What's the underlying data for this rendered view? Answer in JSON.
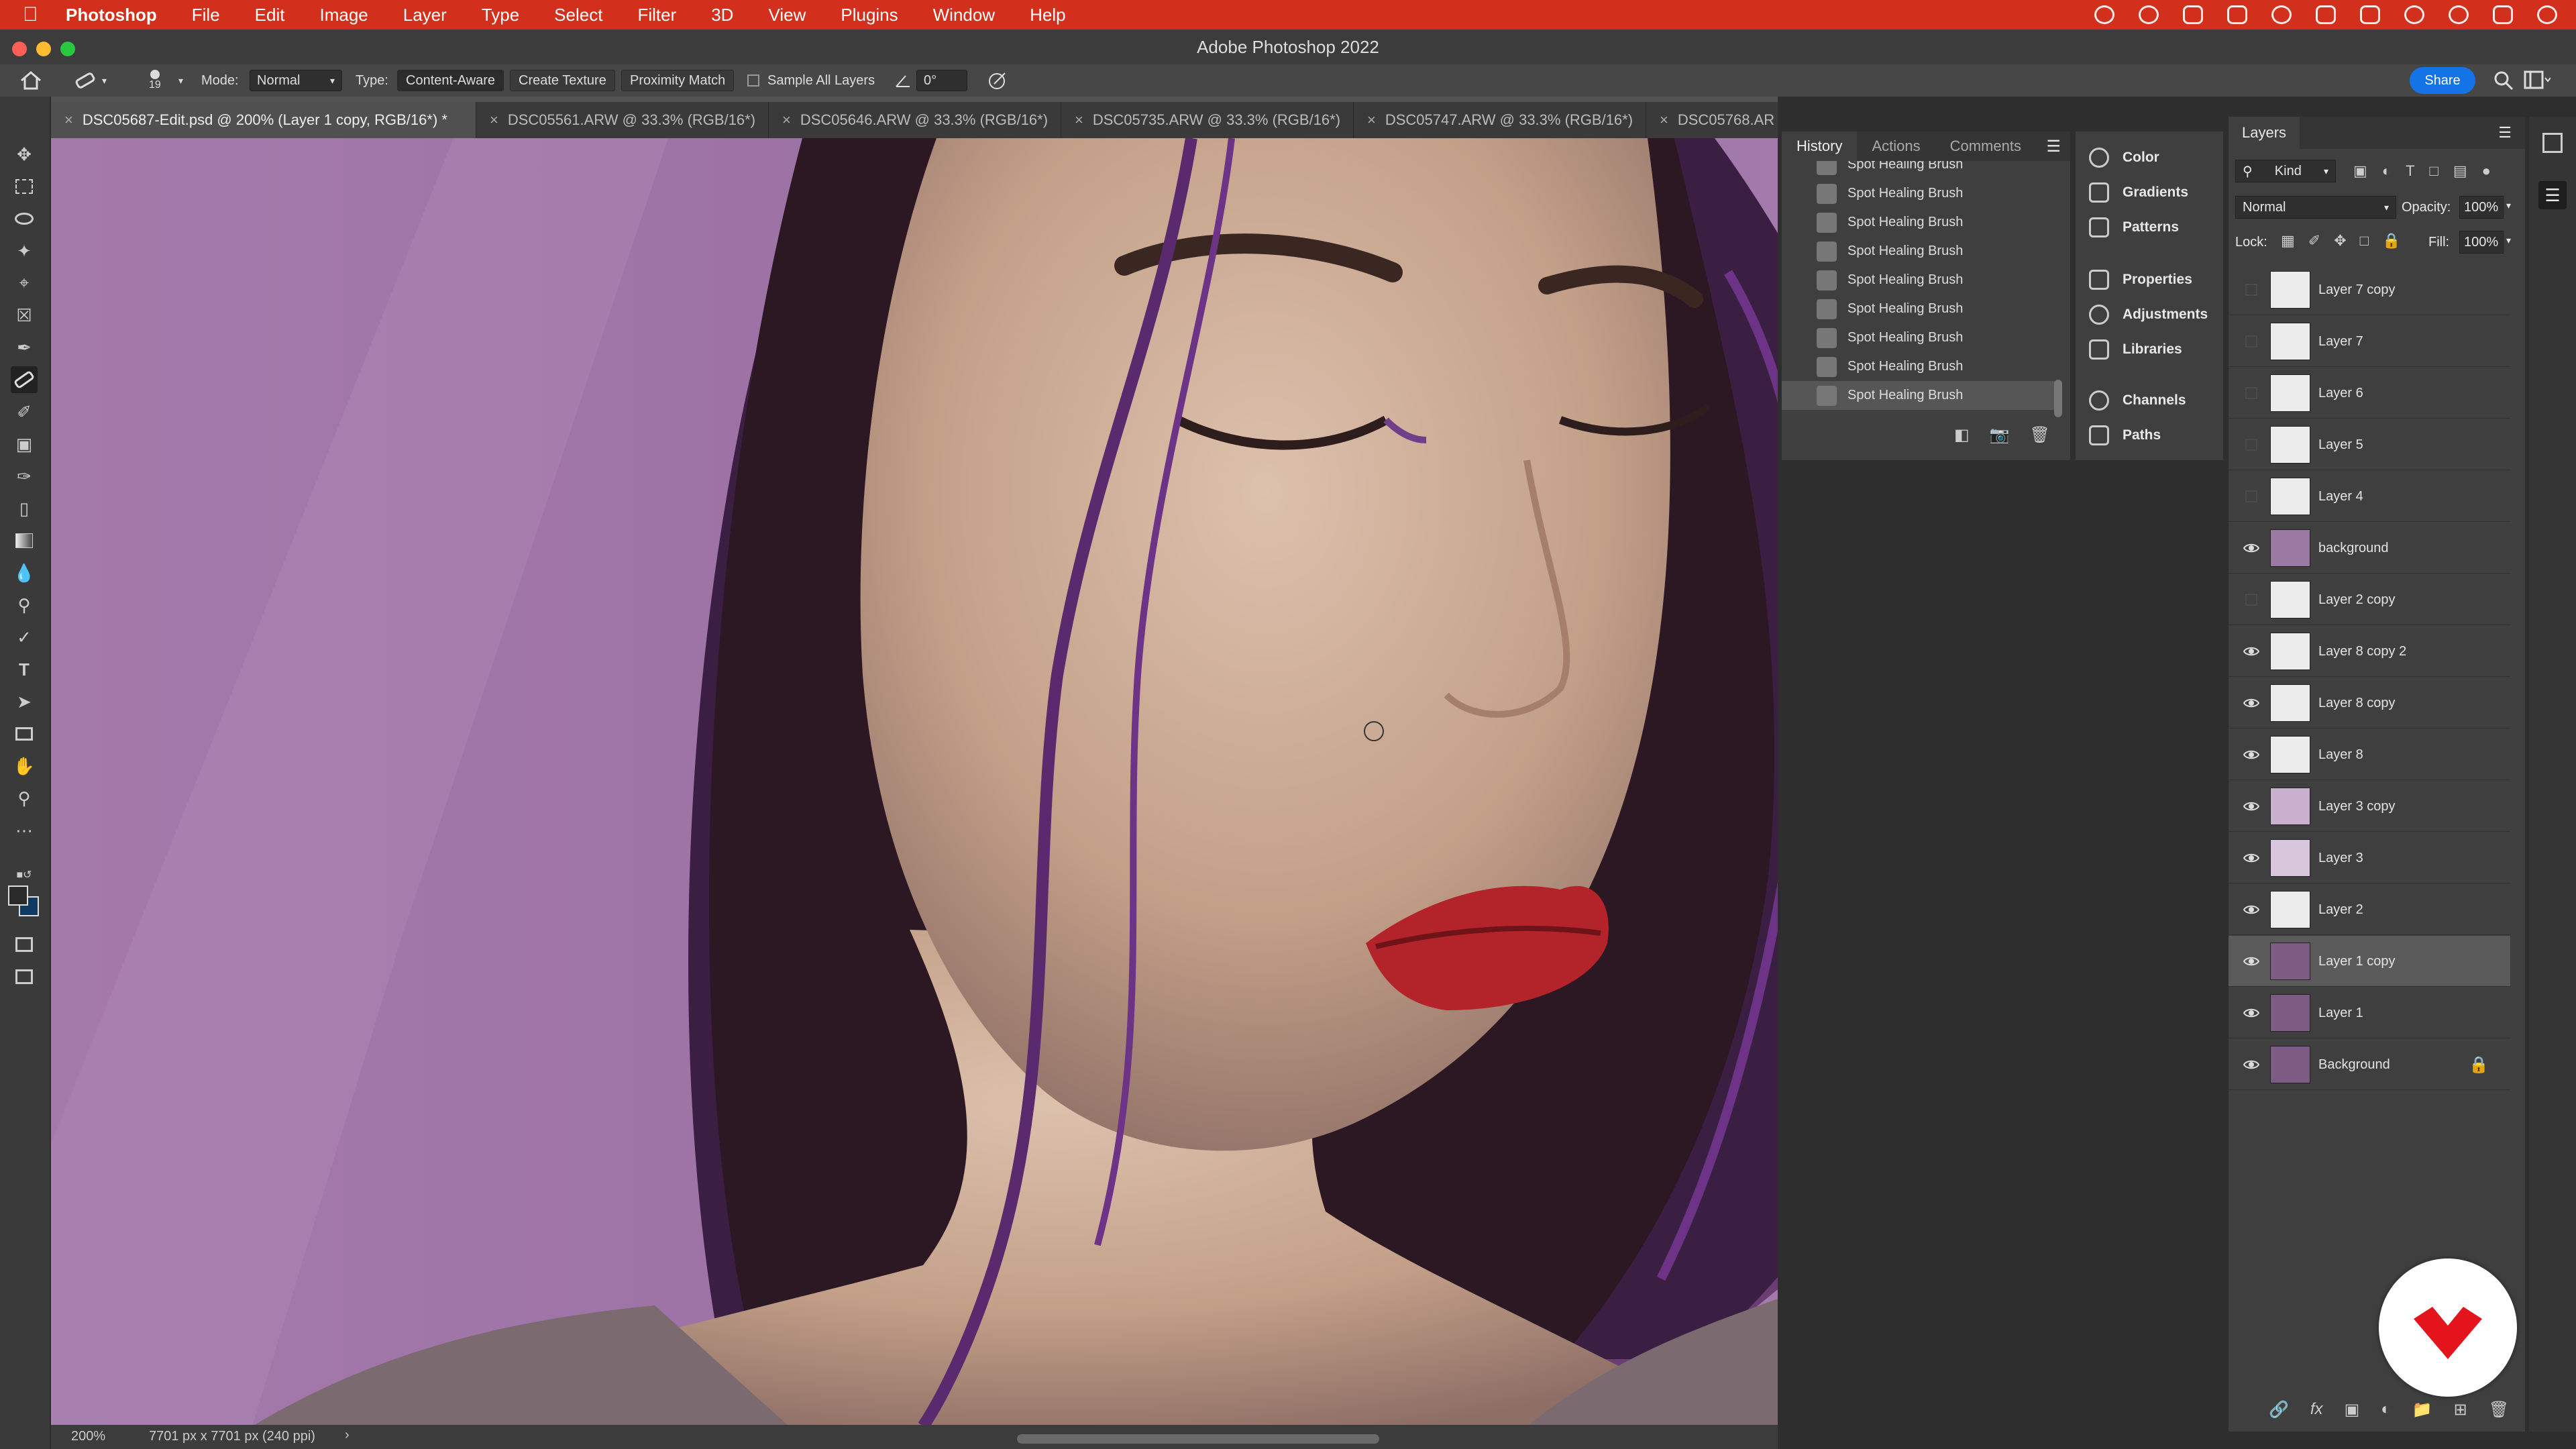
{
  "menubar": {
    "app": "Photoshop",
    "items": [
      "File",
      "Edit",
      "Image",
      "Layer",
      "Type",
      "Select",
      "Filter",
      "3D",
      "View",
      "Plugins",
      "Window",
      "Help"
    ]
  },
  "window": {
    "title": "Adobe Photoshop 2022"
  },
  "options": {
    "brush_size": "19",
    "mode_label": "Mode:",
    "mode_value": "Normal",
    "type_label": "Type:",
    "type_content_aware": "Content-Aware",
    "type_create_texture": "Create Texture",
    "type_proximity_match": "Proximity Match",
    "sample_all_layers": "Sample All Layers",
    "angle": "0°",
    "share": "Share"
  },
  "tabs": [
    {
      "label": "DSC05687-Edit.psd @ 200% (Layer 1 copy, RGB/16*) *"
    },
    {
      "label": "DSC05561.ARW @ 33.3% (RGB/16*)"
    },
    {
      "label": "DSC05646.ARW @ 33.3% (RGB/16*)"
    },
    {
      "label": "DSC05735.ARW @ 33.3% (RGB/16*)"
    },
    {
      "label": "DSC05747.ARW @ 33.3% (RGB/16*)"
    },
    {
      "label": "DSC05768.AR"
    }
  ],
  "status": {
    "zoom": "200%",
    "doc_info": "7701 px x 7701 px (240 ppi)"
  },
  "history": {
    "tabs": [
      "History",
      "Actions",
      "Comments"
    ],
    "items": [
      "Spot Healing Brush",
      "Spot Healing Brush",
      "Spot Healing Brush",
      "Spot Healing Brush",
      "Spot Healing Brush",
      "Spot Healing Brush",
      "Spot Healing Brush",
      "Spot Healing Brush",
      "Spot Healing Brush"
    ]
  },
  "collapsed_panels": [
    "Color",
    "Gradients",
    "Patterns",
    "Properties",
    "Adjustments",
    "Libraries",
    "Channels",
    "Paths"
  ],
  "layers_panel": {
    "title": "Layers",
    "filter_kind": "Kind",
    "blend_mode": "Normal",
    "opacity_label": "Opacity:",
    "opacity_value": "100%",
    "lock_label": "Lock:",
    "fill_label": "Fill:",
    "fill_value": "100%",
    "layers": [
      {
        "name": "Layer 7 copy",
        "visible": false
      },
      {
        "name": "Layer 7",
        "visible": false
      },
      {
        "name": "Layer 6",
        "visible": false
      },
      {
        "name": "Layer 5",
        "visible": false
      },
      {
        "name": "Layer 4",
        "visible": false
      },
      {
        "name": "background",
        "visible": true
      },
      {
        "name": "Layer 2 copy",
        "visible": false
      },
      {
        "name": "Layer 8 copy 2",
        "visible": true
      },
      {
        "name": "Layer 8 copy",
        "visible": true
      },
      {
        "name": "Layer 8",
        "visible": true
      },
      {
        "name": "Layer 3 copy",
        "visible": true
      },
      {
        "name": "Layer 3",
        "visible": true
      },
      {
        "name": "Layer 2",
        "visible": true
      },
      {
        "name": "Layer 1 copy",
        "visible": true,
        "selected": true
      },
      {
        "name": "Layer 1",
        "visible": true
      },
      {
        "name": "Background",
        "visible": true,
        "locked": true
      }
    ]
  },
  "colors": {
    "menubar": "#d2301c",
    "accent": "#1473e6",
    "logo_red": "#e3141c"
  }
}
